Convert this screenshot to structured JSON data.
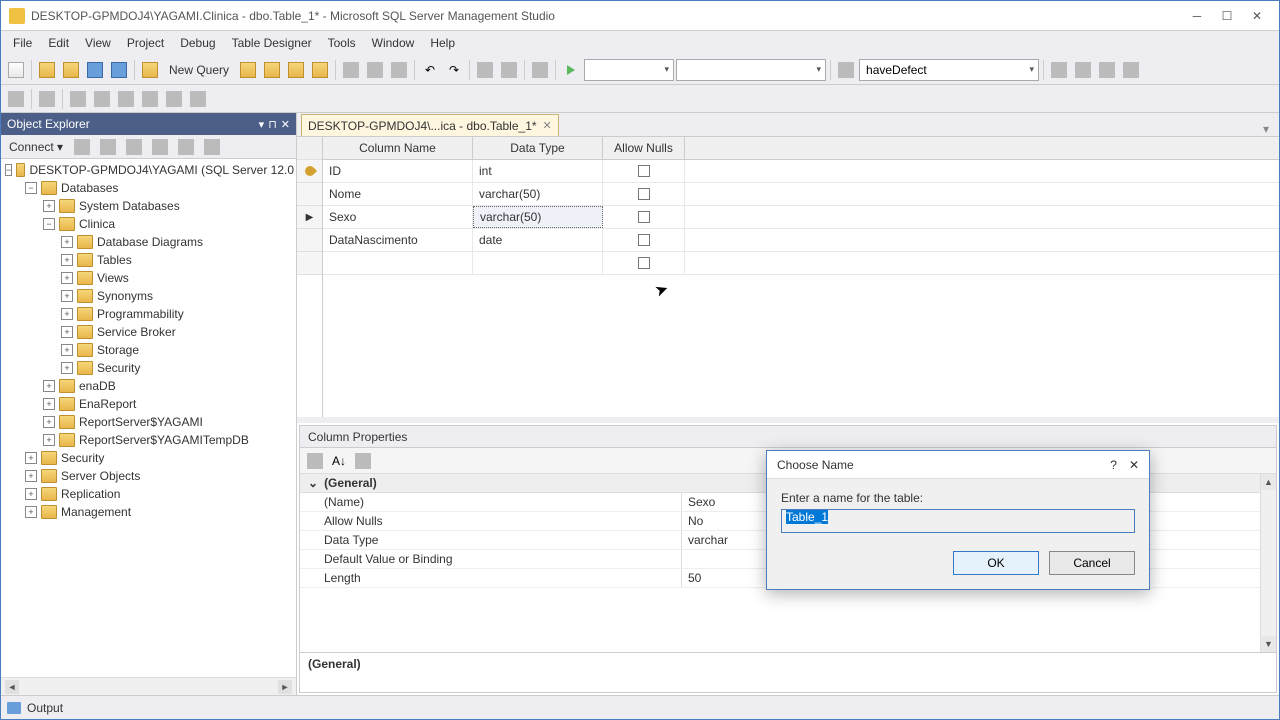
{
  "window": {
    "title": "DESKTOP-GPMDOJ4\\YAGAMI.Clinica - dbo.Table_1* - Microsoft SQL Server Management Studio"
  },
  "menu": [
    "File",
    "Edit",
    "View",
    "Project",
    "Debug",
    "Table Designer",
    "Tools",
    "Window",
    "Help"
  ],
  "toolbar": {
    "newquery": "New Query",
    "combo1": "",
    "combo2": "",
    "combo3": "haveDefect"
  },
  "explorer": {
    "title": "Object Explorer",
    "connect": "Connect ▾",
    "root": "DESKTOP-GPMDOJ4\\YAGAMI (SQL Server 12.0",
    "databases": "Databases",
    "sysdb": "System Databases",
    "clinica": "Clinica",
    "items": [
      "Database Diagrams",
      "Tables",
      "Views",
      "Synonyms",
      "Programmability",
      "Service Broker",
      "Storage",
      "Security"
    ],
    "otherdbs": [
      "enaDB",
      "EnaReport",
      "ReportServer$YAGAMI",
      "ReportServer$YAGAMITempDB"
    ],
    "rootitems": [
      "Security",
      "Server Objects",
      "Replication",
      "Management"
    ]
  },
  "tab": {
    "label": "DESKTOP-GPMDOJ4\\...ica - dbo.Table_1*"
  },
  "grid": {
    "headers": {
      "name": "Column Name",
      "type": "Data Type",
      "nulls": "Allow Nulls"
    },
    "rows": [
      {
        "name": "ID",
        "type": "int",
        "key": true
      },
      {
        "name": "Nome",
        "type": "varchar(50)"
      },
      {
        "name": "Sexo",
        "type": "varchar(50)",
        "current": true
      },
      {
        "name": "DataNascimento",
        "type": "date"
      }
    ]
  },
  "props": {
    "title": "Column Properties",
    "section": "(General)",
    "rows": [
      {
        "k": "(Name)",
        "v": "Sexo"
      },
      {
        "k": "Allow Nulls",
        "v": "No"
      },
      {
        "k": "Data Type",
        "v": "varchar"
      },
      {
        "k": "Default Value or Binding",
        "v": ""
      },
      {
        "k": "Length",
        "v": "50"
      }
    ],
    "footer": "(General)"
  },
  "dialog": {
    "title": "Choose Name",
    "label": "Enter a name for the table:",
    "value": "Table_1",
    "ok": "OK",
    "cancel": "Cancel"
  },
  "output": {
    "label": "Output"
  }
}
